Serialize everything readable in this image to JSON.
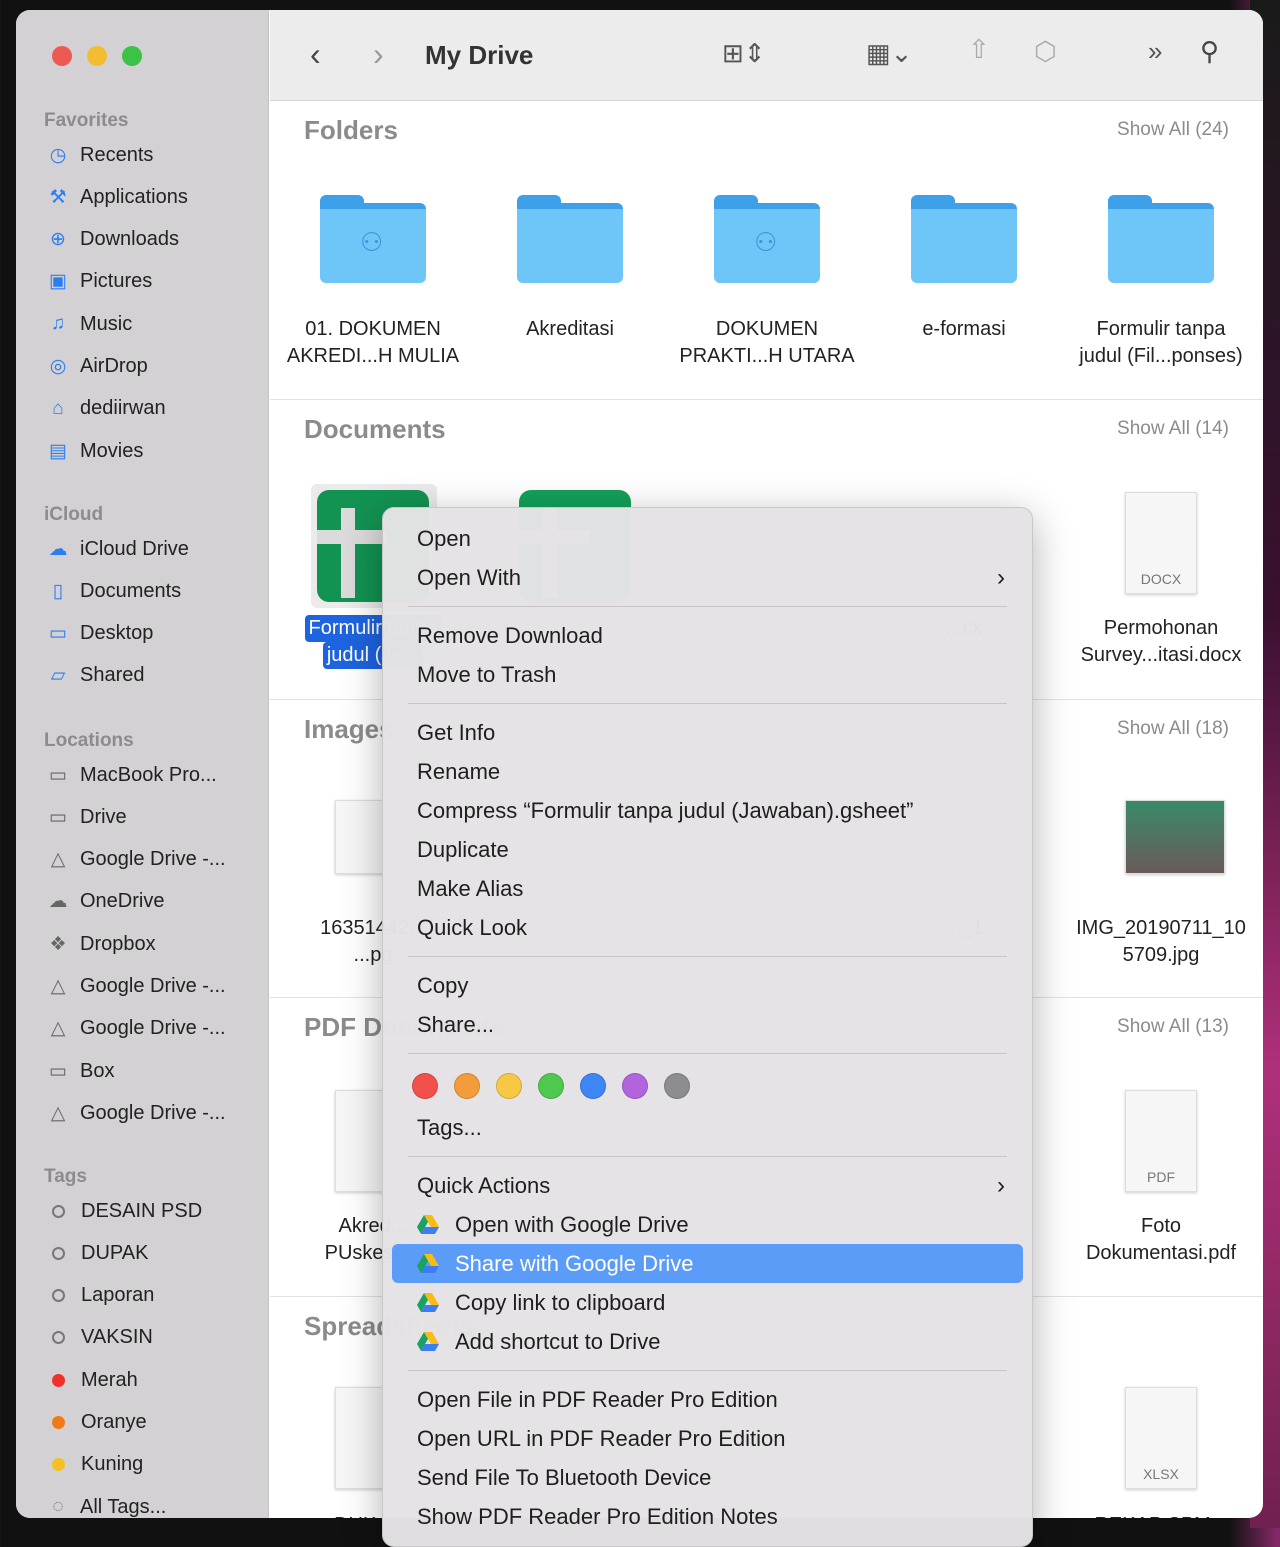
{
  "window": {
    "title": "My Drive"
  },
  "sidebar": {
    "sections": [
      {
        "header": "Favorites",
        "items": [
          {
            "label": "Recents",
            "icon": "clock-icon",
            "g": "◷"
          },
          {
            "label": "Applications",
            "icon": "applications-icon",
            "g": "⚒"
          },
          {
            "label": "Downloads",
            "icon": "download-icon",
            "g": "⊕"
          },
          {
            "label": "Pictures",
            "icon": "pictures-icon",
            "g": "▣"
          },
          {
            "label": "Music",
            "icon": "music-icon",
            "g": "♫"
          },
          {
            "label": "AirDrop",
            "icon": "airdrop-icon",
            "g": "◎"
          },
          {
            "label": "dediirwan",
            "icon": "home-icon",
            "g": "⌂"
          },
          {
            "label": "Movies",
            "icon": "movies-icon",
            "g": "▤"
          }
        ]
      },
      {
        "header": "iCloud",
        "items": [
          {
            "label": "iCloud Drive",
            "icon": "cloud-icon",
            "g": "☁"
          },
          {
            "label": "Documents",
            "icon": "document-icon",
            "g": "▯"
          },
          {
            "label": "Desktop",
            "icon": "desktop-icon",
            "g": "▭"
          },
          {
            "label": "Shared",
            "icon": "shared-folder-icon",
            "g": "▱"
          }
        ]
      },
      {
        "header": "Locations",
        "items": [
          {
            "label": "MacBook Pro...",
            "icon": "laptop-icon",
            "g": "▭"
          },
          {
            "label": "Drive",
            "icon": "drive-icon",
            "g": "▭"
          },
          {
            "label": "Google Drive -...",
            "icon": "google-drive-icon",
            "g": "△"
          },
          {
            "label": "OneDrive",
            "icon": "cloud-icon",
            "g": "☁"
          },
          {
            "label": "Dropbox",
            "icon": "dropbox-icon",
            "g": "❖"
          },
          {
            "label": "Google Drive -...",
            "icon": "google-drive-icon",
            "g": "△"
          },
          {
            "label": "Google Drive -...",
            "icon": "google-drive-icon",
            "g": "△"
          },
          {
            "label": "Box",
            "icon": "box-icon",
            "g": "▭"
          },
          {
            "label": "Google Drive -...",
            "icon": "google-drive-icon",
            "g": "△"
          }
        ]
      },
      {
        "header": "Tags",
        "items": [
          {
            "label": "DESAIN PSD",
            "tag": ""
          },
          {
            "label": "DUPAK",
            "tag": ""
          },
          {
            "label": "Laporan",
            "tag": ""
          },
          {
            "label": "VAKSIN",
            "tag": ""
          },
          {
            "label": "Merah",
            "tag": "#f0302a"
          },
          {
            "label": "Oranye",
            "tag": "#f07a18"
          },
          {
            "label": "Kuning",
            "tag": "#f5c024"
          },
          {
            "label": "All Tags...",
            "icon": "tags-icon",
            "g": "◌"
          }
        ]
      }
    ]
  },
  "sections": [
    {
      "title": "Folders",
      "show_all": "Show All (24)",
      "items": [
        "01. DOKUMEN\nAKREDI...H MULIA",
        "Akreditasi",
        "DOKUMEN\nPRAKTI...H UTARA",
        "e-formasi",
        "Formulir tanpa\njudul (Fil...ponses)"
      ]
    },
    {
      "title": "Documents",
      "show_all": "Show All (14)",
      "items": [
        "Formulir tanpa\njudul (Ja...",
        "",
        "",
        "...cx",
        "Permohonan\nSurvey...itasi.docx"
      ],
      "docx_badge": "DOCX"
    },
    {
      "title": "Images",
      "show_all": "Show All (18)",
      "items": [
        "16351442...\n...pg",
        "",
        "",
        "..._1",
        "IMG_20190711_10\n5709.jpg"
      ]
    },
    {
      "title": "PDF Documents",
      "show_all": "Show All (13)",
      "items": [
        "Akred...\nPUskes...2",
        "",
        "",
        "",
        "Foto\nDokumentasi.pdf"
      ],
      "pdf_badge": "PDF"
    },
    {
      "title": "Spreadsheets",
      "show_all": "",
      "items": [
        "DUK B...",
        "",
        "",
        "",
        "REKAP SPM..."
      ],
      "xlsx_badge": "XLSX"
    }
  ],
  "menu": {
    "groups": [
      [
        {
          "label": "Open"
        },
        {
          "label": "Open With",
          "submenu": true
        }
      ],
      [
        {
          "label": "Remove Download"
        },
        {
          "label": "Move to Trash"
        }
      ],
      [
        {
          "label": "Get Info"
        },
        {
          "label": "Rename"
        },
        {
          "label": "Compress “Formulir tanpa judul (Jawaban).gsheet”"
        },
        {
          "label": "Duplicate"
        },
        {
          "label": "Make Alias"
        },
        {
          "label": "Quick Look"
        }
      ],
      [
        {
          "label": "Copy"
        },
        {
          "label": "Share..."
        }
      ],
      "TAGS",
      [
        {
          "label": "Quick Actions",
          "submenu": true
        },
        {
          "label": "Open with Google Drive",
          "gd": true
        },
        {
          "label": "Share with Google Drive",
          "gd": true,
          "highlighted": true
        },
        {
          "label": "Copy link to clipboard",
          "gd": true
        },
        {
          "label": "Add shortcut to Drive",
          "gd": true
        }
      ],
      [
        {
          "label": "Open File in PDF Reader Pro Edition"
        },
        {
          "label": "Open URL in PDF Reader Pro Edition"
        },
        {
          "label": "Send File To Bluetooth Device"
        },
        {
          "label": "Show PDF Reader Pro Edition Notes"
        }
      ]
    ],
    "tag_colors": [
      "#f2514b",
      "#f39c3c",
      "#f6c843",
      "#4fc84f",
      "#3e86f3",
      "#b164dd",
      "#8d8d8f"
    ],
    "tags_label": "Tags..."
  },
  "colors": {
    "accent": "#2a6fe0",
    "highlight": "#5a9cf8",
    "folder": "#6ec6f8",
    "sheets": "#14a05a"
  }
}
